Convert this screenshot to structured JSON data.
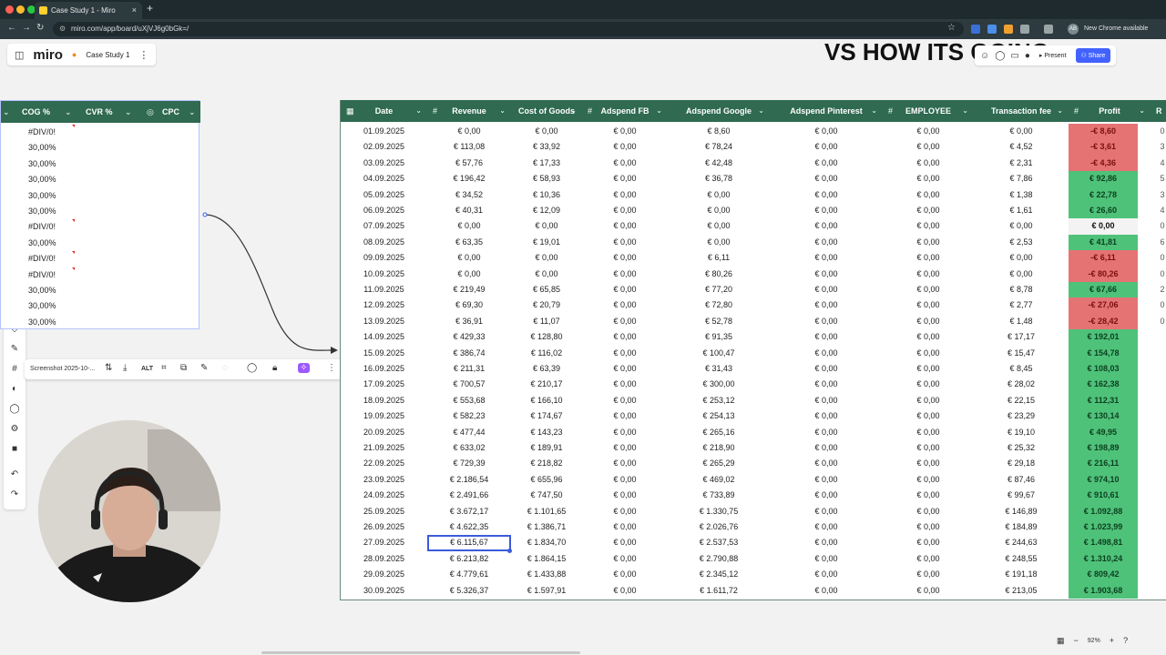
{
  "browser": {
    "tab_title": "Case Study 1 - Miro",
    "tab_close": "×",
    "new_tab": "+",
    "url": "miro.com/app/board/uXjVJ6g0bGk=/",
    "new_chrome": "New Chrome available",
    "avatar": "AB"
  },
  "miro": {
    "logo": "miro",
    "board_name": "Case Study 1",
    "heading_partial": "VS HOW ITS GOING",
    "present": "Present",
    "share": "Share"
  },
  "left_table": {
    "headers": [
      "COG %",
      "CVR %",
      "CPC"
    ],
    "rows": [
      "#DIV/0!",
      "30,00%",
      "30,00%",
      "30,00%",
      "30,00%",
      "30,00%",
      "#DIV/0!",
      "30,00%",
      "#DIV/0!",
      "#DIV/0!",
      "30,00%",
      "30,00%",
      "30,00%"
    ]
  },
  "context_toolbar": {
    "label": "Screenshot 2025-10-...",
    "alt": "ALT"
  },
  "main_table": {
    "headers": [
      "Date",
      "Revenue",
      "Cost of Goods",
      "Adspend FB",
      "Adspend Google",
      "Adspend Pinterest",
      "EMPLOYEE",
      "Transaction fee",
      "Profit",
      "R"
    ],
    "rows": [
      [
        "01.09.2025",
        "€ 0,00",
        "€ 0,00",
        "€ 0,00",
        "€ 8,60",
        "€ 0,00",
        "€ 0,00",
        "€ 0,00",
        "-€ 8,60"
      ],
      [
        "02.09.2025",
        "€ 113,08",
        "€ 33,92",
        "€ 0,00",
        "€ 78,24",
        "€ 0,00",
        "€ 0,00",
        "€ 4,52",
        "-€ 3,61"
      ],
      [
        "03.09.2025",
        "€ 57,76",
        "€ 17,33",
        "€ 0,00",
        "€ 42,48",
        "€ 0,00",
        "€ 0,00",
        "€ 2,31",
        "-€ 4,36"
      ],
      [
        "04.09.2025",
        "€ 196,42",
        "€ 58,93",
        "€ 0,00",
        "€ 36,78",
        "€ 0,00",
        "€ 0,00",
        "€ 7,86",
        "€ 92,86"
      ],
      [
        "05.09.2025",
        "€ 34,52",
        "€ 10,36",
        "€ 0,00",
        "€ 0,00",
        "€ 0,00",
        "€ 0,00",
        "€ 1,38",
        "€ 22,78"
      ],
      [
        "06.09.2025",
        "€ 40,31",
        "€ 12,09",
        "€ 0,00",
        "€ 0,00",
        "€ 0,00",
        "€ 0,00",
        "€ 1,61",
        "€ 26,60"
      ],
      [
        "07.09.2025",
        "€ 0,00",
        "€ 0,00",
        "€ 0,00",
        "€ 0,00",
        "€ 0,00",
        "€ 0,00",
        "€ 0,00",
        "€ 0,00"
      ],
      [
        "08.09.2025",
        "€ 63,35",
        "€ 19,01",
        "€ 0,00",
        "€ 0,00",
        "€ 0,00",
        "€ 0,00",
        "€ 2,53",
        "€ 41,81"
      ],
      [
        "09.09.2025",
        "€ 0,00",
        "€ 0,00",
        "€ 0,00",
        "€ 6,11",
        "€ 0,00",
        "€ 0,00",
        "€ 0,00",
        "-€ 6,11"
      ],
      [
        "10.09.2025",
        "€ 0,00",
        "€ 0,00",
        "€ 0,00",
        "€ 80,26",
        "€ 0,00",
        "€ 0,00",
        "€ 0,00",
        "-€ 80,26"
      ],
      [
        "11.09.2025",
        "€ 219,49",
        "€ 65,85",
        "€ 0,00",
        "€ 77,20",
        "€ 0,00",
        "€ 0,00",
        "€ 8,78",
        "€ 67,66"
      ],
      [
        "12.09.2025",
        "€ 69,30",
        "€ 20,79",
        "€ 0,00",
        "€ 72,80",
        "€ 0,00",
        "€ 0,00",
        "€ 2,77",
        "-€ 27,06"
      ],
      [
        "13.09.2025",
        "€ 36,91",
        "€ 11,07",
        "€ 0,00",
        "€ 52,78",
        "€ 0,00",
        "€ 0,00",
        "€ 1,48",
        "-€ 28,42"
      ],
      [
        "14.09.2025",
        "€ 429,33",
        "€ 128,80",
        "€ 0,00",
        "€ 91,35",
        "€ 0,00",
        "€ 0,00",
        "€ 17,17",
        "€ 192,01"
      ],
      [
        "15.09.2025",
        "€ 386,74",
        "€ 116,02",
        "€ 0,00",
        "€ 100,47",
        "€ 0,00",
        "€ 0,00",
        "€ 15,47",
        "€ 154,78"
      ],
      [
        "16.09.2025",
        "€ 211,31",
        "€ 63,39",
        "€ 0,00",
        "€ 31,43",
        "€ 0,00",
        "€ 0,00",
        "€ 8,45",
        "€ 108,03"
      ],
      [
        "17.09.2025",
        "€ 700,57",
        "€ 210,17",
        "€ 0,00",
        "€ 300,00",
        "€ 0,00",
        "€ 0,00",
        "€ 28,02",
        "€ 162,38"
      ],
      [
        "18.09.2025",
        "€ 553,68",
        "€ 166,10",
        "€ 0,00",
        "€ 253,12",
        "€ 0,00",
        "€ 0,00",
        "€ 22,15",
        "€ 112,31"
      ],
      [
        "19.09.2025",
        "€ 582,23",
        "€ 174,67",
        "€ 0,00",
        "€ 254,13",
        "€ 0,00",
        "€ 0,00",
        "€ 23,29",
        "€ 130,14"
      ],
      [
        "20.09.2025",
        "€ 477,44",
        "€ 143,23",
        "€ 0,00",
        "€ 265,16",
        "€ 0,00",
        "€ 0,00",
        "€ 19,10",
        "€ 49,95"
      ],
      [
        "21.09.2025",
        "€ 633,02",
        "€ 189,91",
        "€ 0,00",
        "€ 218,90",
        "€ 0,00",
        "€ 0,00",
        "€ 25,32",
        "€ 198,89"
      ],
      [
        "22.09.2025",
        "€ 729,39",
        "€ 218,82",
        "€ 0,00",
        "€ 265,29",
        "€ 0,00",
        "€ 0,00",
        "€ 29,18",
        "€ 216,11"
      ],
      [
        "23.09.2025",
        "€ 2.186,54",
        "€ 655,96",
        "€ 0,00",
        "€ 469,02",
        "€ 0,00",
        "€ 0,00",
        "€ 87,46",
        "€ 974,10"
      ],
      [
        "24.09.2025",
        "€ 2.491,66",
        "€ 747,50",
        "€ 0,00",
        "€ 733,89",
        "€ 0,00",
        "€ 0,00",
        "€ 99,67",
        "€ 910,61"
      ],
      [
        "25.09.2025",
        "€ 3.672,17",
        "€ 1.101,65",
        "€ 0,00",
        "€ 1.330,75",
        "€ 0,00",
        "€ 0,00",
        "€ 146,89",
        "€ 1.092,88"
      ],
      [
        "26.09.2025",
        "€ 4.622,35",
        "€ 1.386,71",
        "€ 0,00",
        "€ 2.026,76",
        "€ 0,00",
        "€ 0,00",
        "€ 184,89",
        "€ 1.023,99"
      ],
      [
        "27.09.2025",
        "€ 6.115,67",
        "€ 1.834,70",
        "€ 0,00",
        "€ 2.537,53",
        "€ 0,00",
        "€ 0,00",
        "€ 244,63",
        "€ 1.498,81"
      ],
      [
        "28.09.2025",
        "€ 6.213,82",
        "€ 1.864,15",
        "€ 0,00",
        "€ 2.790,88",
        "€ 0,00",
        "€ 0,00",
        "€ 248,55",
        "€ 1.310,24"
      ],
      [
        "29.09.2025",
        "€ 4.779,61",
        "€ 1.433,88",
        "€ 0,00",
        "€ 2.345,12",
        "€ 0,00",
        "€ 0,00",
        "€ 191,18",
        "€ 809,42"
      ],
      [
        "30.09.2025",
        "€ 5.326,37",
        "€ 1.597,91",
        "€ 0,00",
        "€ 1.611,72",
        "€ 0,00",
        "€ 0,00",
        "€ 213,05",
        "€ 1.903,68"
      ]
    ],
    "profit_status": [
      "neg",
      "neg",
      "neg",
      "pos",
      "pos",
      "pos",
      "zero",
      "pos",
      "neg",
      "neg",
      "pos",
      "neg",
      "neg",
      "pos",
      "pos",
      "pos",
      "pos",
      "pos",
      "pos",
      "pos",
      "pos",
      "pos",
      "pos",
      "pos",
      "pos",
      "pos",
      "pos",
      "pos",
      "pos",
      "pos"
    ],
    "right_partial": [
      "0",
      "3",
      "4",
      "5",
      "3",
      "4",
      "0",
      "6",
      "0",
      "0",
      "2",
      "0",
      "0",
      "",
      "",
      "",
      "",
      "",
      "",
      "",
      "",
      "",
      "",
      "",
      "",
      "",
      "",
      "",
      "",
      ""
    ],
    "selected_row": 26,
    "colors": {
      "header": "#2f6a51",
      "positive": "#4fc27a",
      "negative": "#e57373"
    }
  },
  "zoom": {
    "level": "92%"
  }
}
